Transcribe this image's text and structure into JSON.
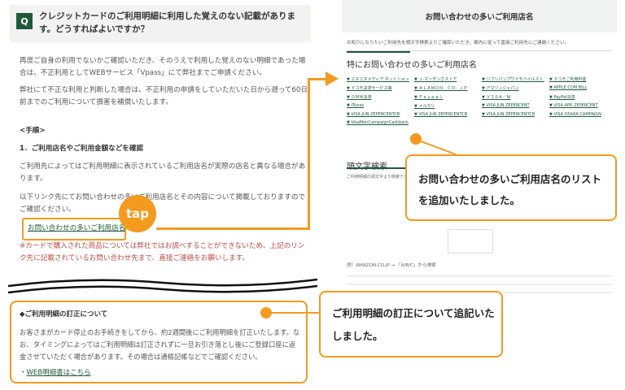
{
  "left": {
    "question_badge": "Q",
    "question_title": "クレジットカードのご利用明細に利用した覚えのない記載があります。どうすればよいですか？",
    "para1": "再度ご自身の利用でないかご確認いただき、そのうえで利用した覚えのない明細であった場合は、不正利用としてWEBサービス「Vpass」にて弊社までご申請ください。",
    "para2": "弊社にて不正な利用と判断した場合は、不正利用の申請をしていただいた日から遡って60日前までのご利用について損害を補償いたします。",
    "steps_heading": "<手順>",
    "step1_heading": "1．ご利用店名やご利用金額などを確認",
    "para3": "ご利用先によってはご利用明細に表示されているご利用店名が実際の店名と異なる場合があります。",
    "para4": "以下リンク先にてお問い合わせの多いご利用店名とその内容について掲載しておりますのでご確認ください。",
    "link_stores": "お問い合わせの多いご利用店名",
    "note": "※カードで購入された商品については弊社ではお調べすることができないため、上記のリンク先に記載されているお問い合わせ先まで、直接ご連絡をお願いします。",
    "tap_label": "tap",
    "correction_heading": "◆ご利用明細の訂正について",
    "correction_body": "お客さまがカード停止のお手続きをしてから、約2週間後にご利用明細を訂正いたします。なお、タイミングによってはご利用明細は訂正されずに一旦お引き落とし後にご登録口座に返金させていただく場合があります。その場合は通帳記帳などでご確認ください。",
    "web_link_prefix": "・",
    "web_link": "WEB明細書はこちら"
  },
  "right": {
    "header": "お問い合わせの多いご利用店名",
    "intro": "お知りになりたいご利用先を頭文字検索よりご確認いただき、案内に従って直接ご利用先にご連絡ください。",
    "section_title": "特にお問い合わせの多いご利用店名",
    "stores": [
      "エヌエヌメディア ネットショッピング",
      "Ｊ-マッチングストア",
      "ジブリパンプワイモバイルストア",
      "ドコモご利用料金",
      "ドコモ決済サービス等",
      "ＡＬＡＭＯＮ．ＣＯ．ＪＰ",
      "アマゾンジャパン",
      "APPLE COM BILL",
      "ＤＭＭ決済",
      "Ｐａｙｐａｌ",
      "ＶＩＳＡ／Ｍ",
      "PayPal決済",
      "iTunes",
      "メルカリ",
      "VISA JUN ZEPERCENT",
      "VISA APR ZEPERCENT",
      "VISA JUN ZEPERCENTCB",
      "VISA JUN ZEPERCENTCB",
      "VISA JUN ZEPERCENTCB",
      "VISA OSAKA CAMPAIGN",
      "VisaMonCampaignCashback"
    ],
    "section2_title": "頭文字検索",
    "section2_note": "ご利用明細の頭文字より検索できます。",
    "example_text": "例）AMAZON.CO.JP → 「A/B/C」から検索"
  },
  "callouts": {
    "stores_callout": "お問い合わせの多いご利用店名のリストを追加いたしました。",
    "correction_callout": "ご利用明細の訂正について追記いたしました。"
  },
  "colors": {
    "accent": "#f39a1f",
    "brand": "#1f5a3a"
  }
}
